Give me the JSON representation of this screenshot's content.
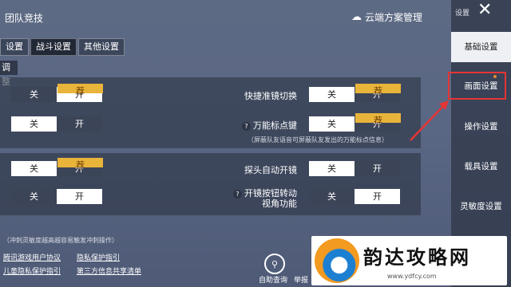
{
  "header": {
    "title": "团队竞技",
    "cloud_label": "云端方案管理",
    "close_glyph": "✕",
    "sidebar_header": "设置"
  },
  "tabs": [
    {
      "label": "设置"
    },
    {
      "label": "战斗设置"
    },
    {
      "label": "其他设置"
    }
  ],
  "section_label": "调整",
  "left_toggles": [
    {
      "off": "关",
      "on": "开",
      "tag": "荐"
    },
    {
      "off": "关",
      "on": "开"
    },
    {
      "off": "关",
      "on": "开",
      "tag": "荐"
    },
    {
      "off": "关",
      "on": "开"
    }
  ],
  "right_settings": [
    {
      "label": "快捷准镜切换",
      "off": "关",
      "on": "开",
      "tag": "荐"
    },
    {
      "label": "万能标点键",
      "off": "关",
      "on": "开",
      "tag": "荐",
      "hint": "（屏蔽队友语音可屏蔽队友发出的万能标点信息）"
    },
    {
      "label": "探头自动开镜",
      "off": "关",
      "on": "开"
    },
    {
      "label_line1": "开镜按钮转动",
      "label_line2": "视角功能",
      "off": "关",
      "on": "开"
    }
  ],
  "note": "（冲刺灵敏度越高越容易触发冲刺操作）",
  "links": [
    "腾讯游戏用户协议",
    "隐私保护指引",
    "儿童隐私保护指引",
    "第三方信息共享清单"
  ],
  "actions": {
    "help_label": "自助查询",
    "report_label": "举报"
  },
  "sidebar_items": [
    {
      "label": "基础设置"
    },
    {
      "label": "画面设置"
    },
    {
      "label": "操作设置"
    },
    {
      "label": "载具设置"
    },
    {
      "label": "灵敏度设置"
    }
  ],
  "watermark": {
    "title": "韵达攻略网",
    "url": "www.ydfcy.com"
  },
  "colors": {
    "highlight": "#e53535",
    "recommend_tag": "#e9b43a"
  }
}
